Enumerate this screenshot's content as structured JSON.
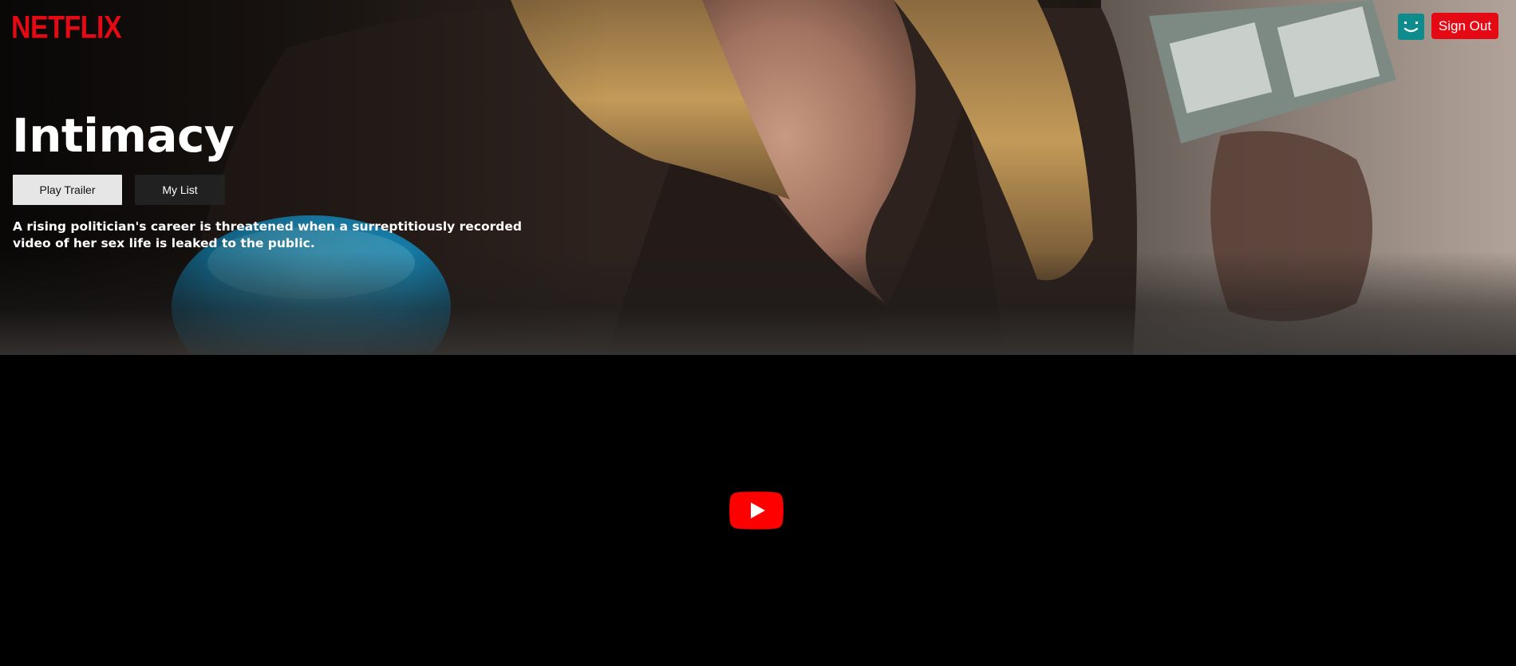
{
  "app": {
    "logo_text": "NETFLIX",
    "brand_color": "#e50914"
  },
  "header": {
    "avatar_icon": "smiley-face-icon",
    "avatar_color": "#0e8b8c",
    "signout_label": "Sign Out"
  },
  "hero": {
    "title": "Intimacy",
    "play_trailer_label": "Play Trailer",
    "my_list_label": "My List",
    "description": "A rising politician's career is threatened when a surreptitiously recorded video of her sex life is leaked to the public."
  },
  "video": {
    "play_icon": "youtube-play-icon",
    "play_color": "#ff0000"
  }
}
